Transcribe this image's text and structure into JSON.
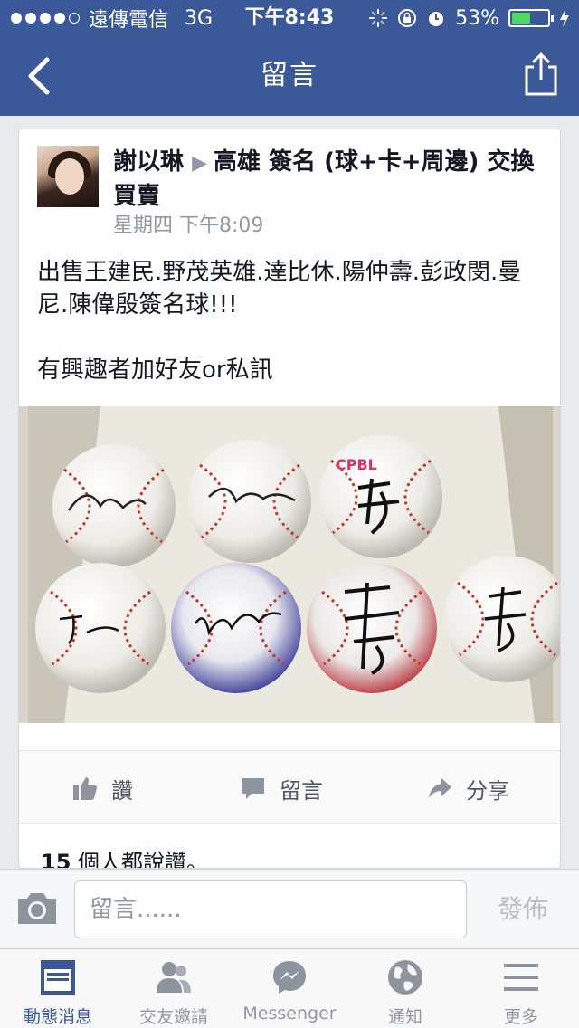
{
  "status_bar": {
    "carrier": "遠傳電信",
    "network": "3G",
    "time": "下午8:43",
    "battery_percent": "53%",
    "battery_level": 0.53,
    "signal_bars_filled": 4,
    "signal_bars_total": 5
  },
  "nav": {
    "title": "留言",
    "back_icon": "chevron-left-icon",
    "share_icon": "share-icon"
  },
  "post": {
    "author": "謝以琳",
    "group": "高雄 簽名 (球+卡+周邊) 交換買賣",
    "timestamp": "星期四 下午8:09",
    "body_lines": [
      "出售王建民.野茂英雄.達比休.陽仲壽.彭政閔.曼尼.陳偉殷簽名球!!!",
      "有興趣者加好友or私訊"
    ],
    "photo_text": "CPBL",
    "likes_number": "15",
    "likes_text": " 個人都說讚。"
  },
  "actions": {
    "like": "讚",
    "comment": "留言",
    "share": "分享"
  },
  "comment_bar": {
    "placeholder": "留言......",
    "publish": "發佈"
  },
  "tabs": [
    {
      "label": "動態消息",
      "icon": "news-feed-icon",
      "active": true
    },
    {
      "label": "交友邀請",
      "icon": "friends-icon",
      "active": false
    },
    {
      "label": "Messenger",
      "icon": "messenger-icon",
      "active": false
    },
    {
      "label": "通知",
      "icon": "globe-icon",
      "active": false
    },
    {
      "label": "更多",
      "icon": "menu-icon",
      "active": false
    }
  ],
  "colors": {
    "brand": "#3b5998",
    "tab_inactive": "#9197a3",
    "battery": "#4cd964"
  }
}
